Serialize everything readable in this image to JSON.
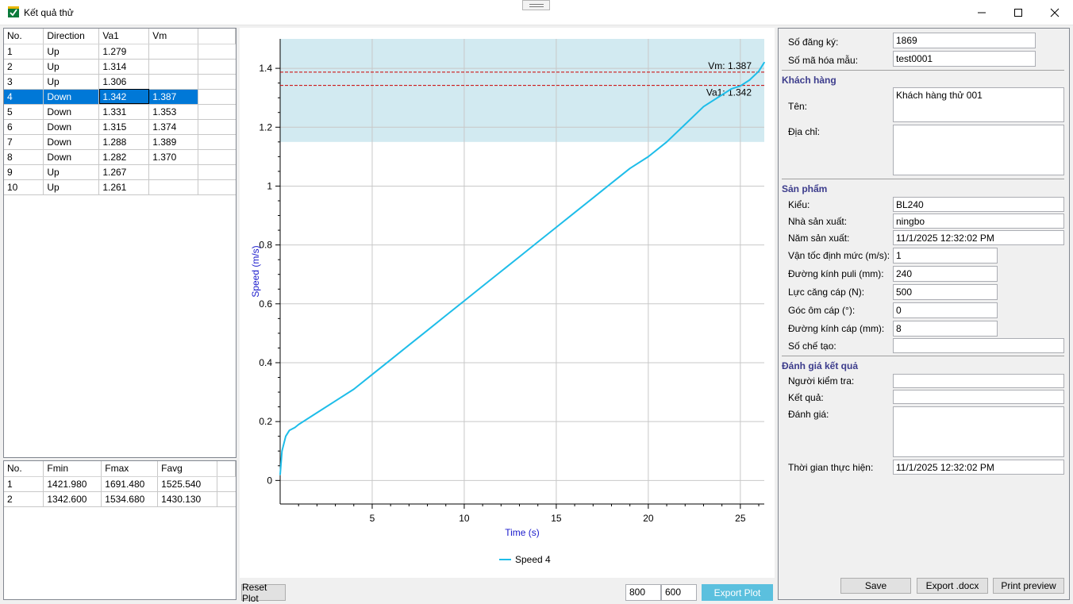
{
  "window": {
    "title": "Kết quả thử"
  },
  "table1": {
    "headers": [
      "No.",
      "Direction",
      "Va1",
      "Vm"
    ],
    "rows": [
      [
        "1",
        "Up",
        "1.279",
        ""
      ],
      [
        "2",
        "Up",
        "1.314",
        ""
      ],
      [
        "3",
        "Up",
        "1.306",
        ""
      ],
      [
        "4",
        "Down",
        "1.342",
        "1.387"
      ],
      [
        "5",
        "Down",
        "1.331",
        "1.353"
      ],
      [
        "6",
        "Down",
        "1.315",
        "1.374"
      ],
      [
        "7",
        "Down",
        "1.288",
        "1.389"
      ],
      [
        "8",
        "Down",
        "1.282",
        "1.370"
      ],
      [
        "9",
        "Up",
        "1.267",
        ""
      ],
      [
        "10",
        "Up",
        "1.261",
        ""
      ]
    ],
    "selected_row": 3
  },
  "table2": {
    "headers": [
      "No.",
      "Fmin",
      "Fmax",
      "Favg"
    ],
    "rows": [
      [
        "1",
        "1421.980",
        "1691.480",
        "1525.540"
      ],
      [
        "2",
        "1342.600",
        "1534.680",
        "1430.130"
      ]
    ]
  },
  "chart_data": {
    "type": "line",
    "xlabel": "Time (s)",
    "ylabel": "Speed (m/s)",
    "xlim": [
      0,
      26.3
    ],
    "ylim": [
      -0.08,
      1.5
    ],
    "xticks": [
      5,
      10,
      15,
      20,
      25
    ],
    "yticks": [
      0,
      0.2,
      0.4,
      0.6,
      0.8,
      1,
      1.2,
      1.4
    ],
    "ytick_labels": [
      "0",
      "0.2",
      "0.4",
      "0.6",
      "0.8",
      "1",
      "1.2",
      "1.4"
    ],
    "grid": true,
    "legend_position": "bottom",
    "shaded_band": [
      1.15,
      1.5
    ],
    "hlines": [
      {
        "label": "Vm: 1.387",
        "value": 1.387,
        "color": "#cc0000"
      },
      {
        "label": "Va1: 1.342",
        "value": 1.342,
        "color": "#cc0000"
      }
    ],
    "series": [
      {
        "name": "Speed 4",
        "color": "#1ebde9",
        "x": [
          0,
          0.1,
          0.3,
          0.5,
          0.8,
          1,
          2,
          3,
          4,
          5,
          6,
          7,
          8,
          9,
          10,
          11,
          12,
          13,
          14,
          15,
          16,
          17,
          18,
          19,
          20,
          21,
          22,
          23,
          24,
          24.5,
          25,
          25.5,
          26,
          26.3
        ],
        "y": [
          0.02,
          0.1,
          0.15,
          0.17,
          0.18,
          0.19,
          0.23,
          0.27,
          0.31,
          0.36,
          0.41,
          0.46,
          0.51,
          0.56,
          0.61,
          0.66,
          0.71,
          0.76,
          0.81,
          0.86,
          0.91,
          0.96,
          1.01,
          1.06,
          1.1,
          1.15,
          1.21,
          1.27,
          1.31,
          1.33,
          1.34,
          1.36,
          1.39,
          1.42
        ]
      }
    ]
  },
  "plot_controls": {
    "reset_label": "Reset Plot",
    "width_value": "800",
    "height_value": "600",
    "export_label": "Export Plot"
  },
  "form": {
    "so_dang_ky_label": "Số đăng ký:",
    "so_dang_ky": "1869",
    "so_ma_hoa_label": "Số mã hóa mẫu:",
    "so_ma_hoa": "test0001",
    "khach_hang_section": "Khách hàng",
    "ten_label": "Tên:",
    "ten": "Khách hàng thử 001",
    "dia_chi_label": "Địa chỉ:",
    "dia_chi": "",
    "san_pham_section": "Sản phẩm",
    "kieu_label": "Kiểu:",
    "kieu": "BL240",
    "nha_sx_label": "Nhà sản xuất:",
    "nha_sx": "ningbo",
    "nam_sx_label": "Năm sản xuất:",
    "nam_sx": "11/1/2025 12:32:02 PM",
    "van_toc_label": "Vận tốc định mức (m/s):",
    "van_toc": "1",
    "duong_kinh_puli_label": "Đường kính puli (mm):",
    "duong_kinh_puli": "240",
    "luc_cang_label": "Lực căng cáp (N):",
    "luc_cang": "500",
    "goc_om_label": "Góc ôm cáp (°):",
    "goc_om": "0",
    "duong_kinh_cap_label": "Đường kính cáp (mm):",
    "duong_kinh_cap": "8",
    "so_che_tao_label": "Số chế tạo:",
    "so_che_tao": "",
    "danh_gia_section": "Đánh giá kết quả",
    "nguoi_kiem_tra_label": "Người kiểm tra:",
    "nguoi_kiem_tra": "",
    "ket_qua_label": "Kết quả:",
    "ket_qua": "",
    "danh_gia_label": "Đánh giá:",
    "danh_gia": "",
    "thoi_gian_label": "Thời gian thực hiện:",
    "thoi_gian": "11/1/2025 12:32:02 PM"
  },
  "actions": {
    "save": "Save",
    "export_docx": "Export .docx",
    "print_preview": "Print preview"
  }
}
